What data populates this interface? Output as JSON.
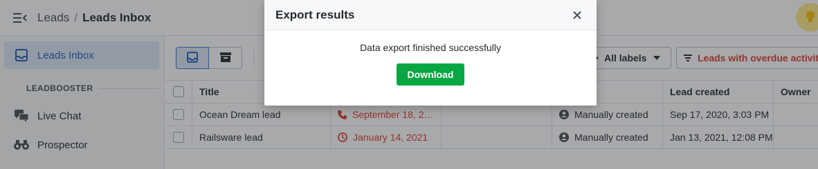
{
  "header": {
    "breadcrumb_root": "Leads",
    "breadcrumb_sep": "/",
    "breadcrumb_current": "Leads Inbox"
  },
  "sidebar": {
    "active_item": "Leads Inbox",
    "section_title": "LEADBOOSTER",
    "items": [
      {
        "label": "Live Chat"
      },
      {
        "label": "Prospector"
      }
    ]
  },
  "toolbar": {
    "labels_filter": "All labels",
    "overdue_filter": "Leads with overdue activity"
  },
  "table": {
    "columns": {
      "title": "Title",
      "created": "Lead created",
      "owner": "Owner"
    },
    "rows": [
      {
        "title": "Ocean Dream lead",
        "next_activity": "September 18, 2…",
        "source": "Manually created",
        "created": "Sep 17, 2020, 3:03 PM"
      },
      {
        "title": "Railsware lead",
        "next_activity": "January 14, 2021",
        "source": "Manually created",
        "created": "Jan 13, 2021, 12:08 PM"
      }
    ]
  },
  "modal": {
    "title": "Export results",
    "message": "Data export finished successfully",
    "button": "Download"
  },
  "colors": {
    "accent": "#317ae2",
    "success": "#08a742",
    "overdue": "#dc3b2e"
  }
}
